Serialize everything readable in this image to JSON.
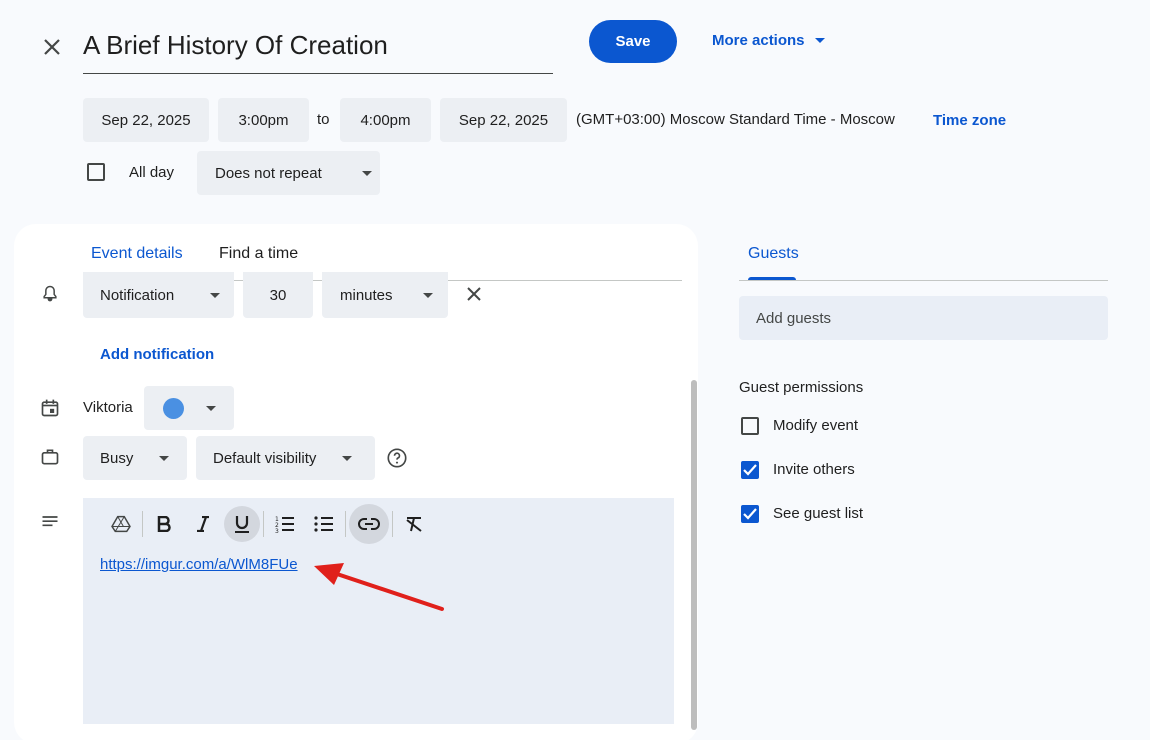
{
  "header": {
    "title": "A Brief History Of Creation",
    "save_label": "Save",
    "more_actions_label": "More actions"
  },
  "datetime": {
    "start_date": "Sep 22, 2025",
    "start_time": "3:00pm",
    "to_label": "to",
    "end_time": "4:00pm",
    "end_date": "Sep 22, 2025",
    "timezone_text": "(GMT+03:00) Moscow Standard Time - Moscow",
    "timezone_link": "Time zone",
    "all_day_label": "All day",
    "all_day_checked": false,
    "repeat_value": "Does not repeat"
  },
  "tabs": [
    {
      "label": "Event details",
      "active": true
    },
    {
      "label": "Find a time",
      "active": false
    }
  ],
  "notification": {
    "type": "Notification",
    "amount": "30",
    "unit": "minutes",
    "add_label": "Add notification"
  },
  "calendar": {
    "owner": "Viktoria",
    "color": "#4a90e2"
  },
  "availability": {
    "status": "Busy",
    "visibility": "Default visibility"
  },
  "description": {
    "link_text": "https://imgur.com/a/WlM8FUe"
  },
  "toolbar_icons": [
    "drive-icon",
    "bold-icon",
    "italic-icon",
    "underline-icon",
    "numbered-list-icon",
    "bulleted-list-icon",
    "link-icon",
    "clear-format-icon"
  ],
  "guests": {
    "tab_label": "Guests",
    "placeholder": "Add guests",
    "permissions_title": "Guest permissions",
    "permissions": [
      {
        "label": "Modify event",
        "checked": false
      },
      {
        "label": "Invite others",
        "checked": true
      },
      {
        "label": "See guest list",
        "checked": true
      }
    ]
  },
  "colors": {
    "accent": "#0b57d0",
    "annotation_arrow": "#e0201b"
  }
}
